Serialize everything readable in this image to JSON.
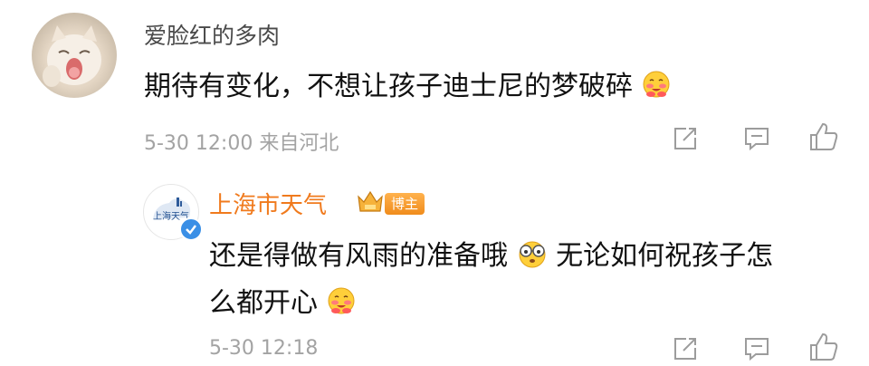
{
  "comment": {
    "username": "爱脸红的多肉",
    "text": "期待有变化，不想让孩子迪士尼的梦破碎",
    "timestamp": "5-30 12:00",
    "location": "来自河北",
    "emoji": "blushing-emoji"
  },
  "reply": {
    "username": "上海市天气",
    "badge": "博主",
    "avatar_text": "上海天气",
    "line1": "还是得做有风雨的准备哦",
    "line1_after": "无论如何祝孩子怎",
    "line2": "么都开心",
    "timestamp": "5-30 12:18",
    "emoji1": "glasses-emoji",
    "emoji2": "blushing-emoji"
  },
  "actions": {
    "share": "share-icon",
    "comment": "comment-icon",
    "like": "like-icon"
  },
  "colors": {
    "username_reply": "#f07a1d",
    "meta": "#a3a3a3",
    "verified": "#3a8fe6",
    "badge": "#f49a2a"
  }
}
